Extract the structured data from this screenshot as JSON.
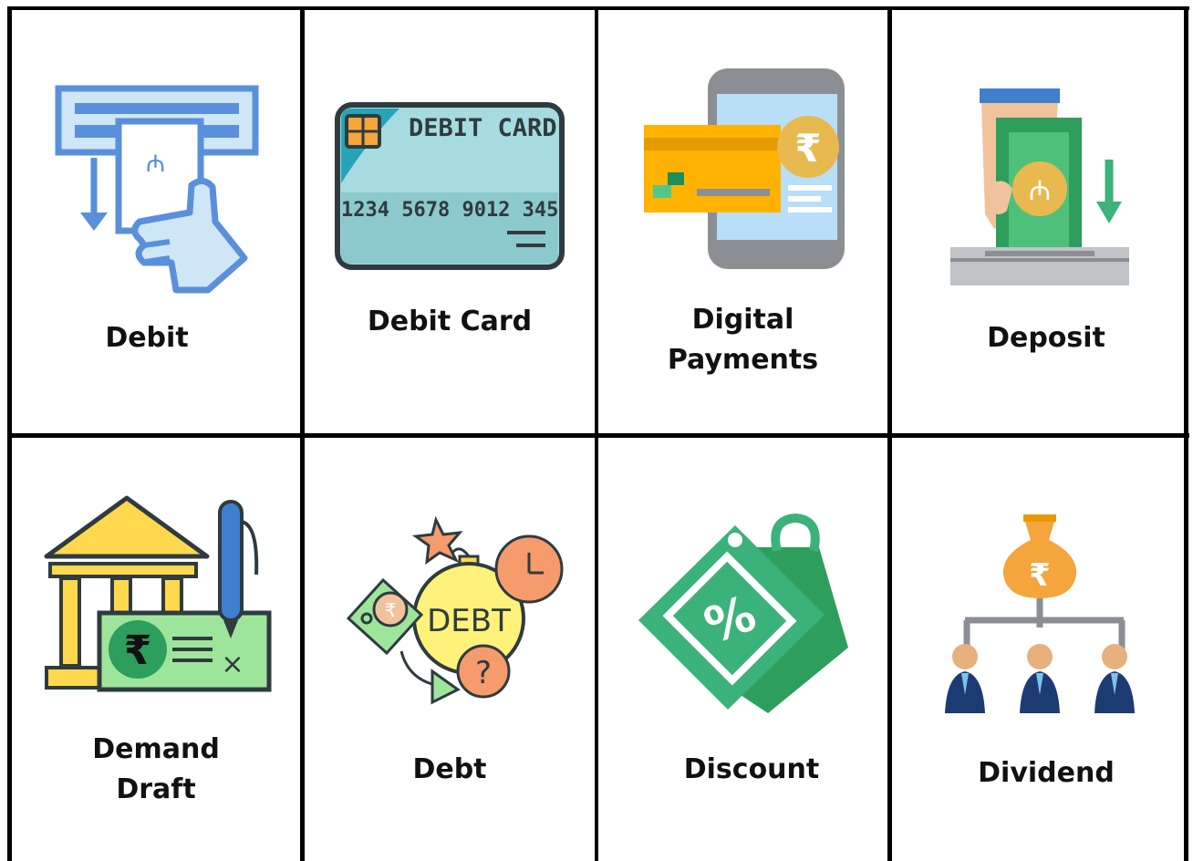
{
  "cards": [
    {
      "id": "debit",
      "lines": [
        "Debit"
      ]
    },
    {
      "id": "debit-card",
      "lines": [
        "Debit Card"
      ],
      "card_text": "DEBIT CARD",
      "card_number": "1234 5678 9012 345"
    },
    {
      "id": "digital-payments",
      "lines": [
        "Digital",
        "Payments"
      ]
    },
    {
      "id": "deposit",
      "lines": [
        "Deposit"
      ]
    },
    {
      "id": "demand-draft",
      "lines": [
        "Demand",
        "Draft"
      ]
    },
    {
      "id": "debt",
      "lines": [
        "Debt"
      ],
      "bomb_text": "DEBT"
    },
    {
      "id": "discount",
      "lines": [
        "Discount"
      ]
    },
    {
      "id": "dividend",
      "lines": [
        "Dividend"
      ]
    }
  ],
  "symbols": {
    "rupee": "₹",
    "question": "?",
    "percent": "%",
    "cross": "×"
  },
  "colors": {
    "blue": "#5a8fdb",
    "light_blue": "#cfe6f7",
    "teal": "#a6dcdf",
    "green": "#3bb27a",
    "yellow": "#ffd84d",
    "orange": "#f4a53c",
    "peach": "#f59b6c",
    "navy": "#1d3b73"
  }
}
